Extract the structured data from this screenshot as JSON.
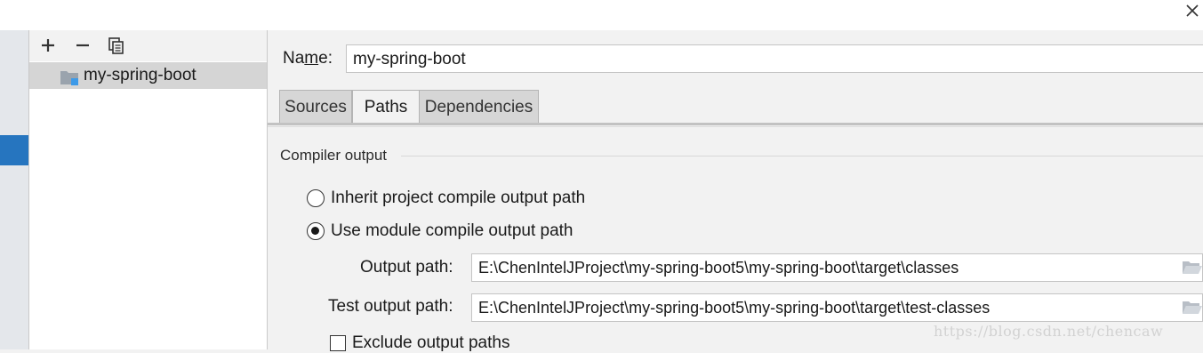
{
  "dialog": {
    "close_icon": "close-icon"
  },
  "module_list": {
    "toolbar": {
      "add_icon": "plus-icon",
      "remove_icon": "minus-icon",
      "copy_icon": "copy-icon"
    },
    "items": [
      {
        "label": "my-spring-boot",
        "icon": "module-folder-icon",
        "selected": true
      }
    ]
  },
  "module": {
    "name_label": "Name:",
    "name_value": "my-spring-boot",
    "tabs": [
      {
        "label": "Sources",
        "active": false
      },
      {
        "label": "Paths",
        "active": true
      },
      {
        "label": "Dependencies",
        "active": false
      }
    ],
    "compiler_output": {
      "title": "Compiler output",
      "options": [
        {
          "label": "Inherit project compile output path",
          "checked": false
        },
        {
          "label": "Use module compile output path",
          "checked": true
        }
      ],
      "output_path_label": "Output path:",
      "output_path_value": "E:\\ChenIntelJProject\\my-spring-boot5\\my-spring-boot\\target\\classes",
      "test_output_path_label": "Test output path:",
      "test_output_path_value": "E:\\ChenIntelJProject\\my-spring-boot5\\my-spring-boot\\target\\test-classes",
      "exclude_label": "Exclude output paths",
      "exclude_checked": false
    }
  },
  "watermark": "https://blog.csdn.net/chencaw",
  "colors": {
    "selection_blue": "#2675bf",
    "selected_row": "#d5d5d5",
    "folder_gray": "#9aa3ad",
    "module_badge": "#3d9ae8"
  }
}
